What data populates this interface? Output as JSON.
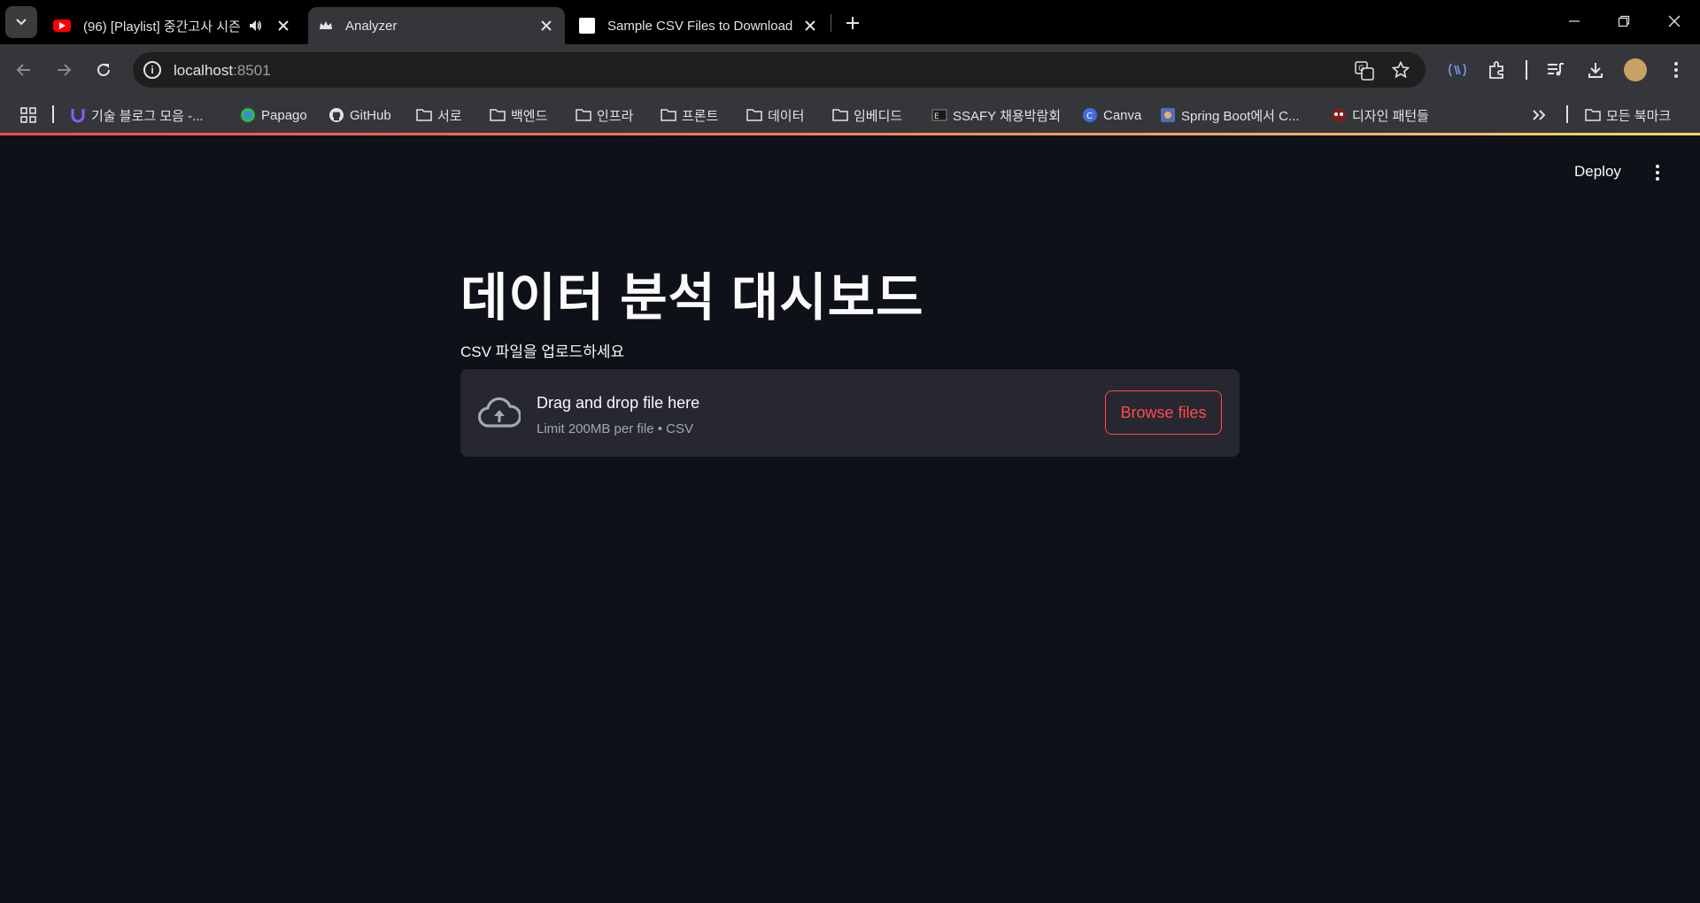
{
  "browser": {
    "tabs": [
      {
        "title": "(96) [Playlist] 중간고사 시즌",
        "favicon": "youtube-icon",
        "active": false
      },
      {
        "title": "Analyzer",
        "favicon": "streamlit-crown-icon",
        "active": true
      },
      {
        "title": "Sample CSV Files to Download",
        "favicon": "page-icon",
        "active": false
      }
    ],
    "address": {
      "host": "localhost",
      "port": ":8501"
    },
    "bookmarks": [
      {
        "label": "기술 블로그 모음 -...",
        "icon": "u-logo-icon"
      },
      {
        "label": "Papago",
        "icon": "papago-icon"
      },
      {
        "label": "GitHub",
        "icon": "github-icon"
      },
      {
        "label": "서로",
        "icon": "folder-icon"
      },
      {
        "label": "백엔드",
        "icon": "folder-icon"
      },
      {
        "label": "인프라",
        "icon": "folder-icon"
      },
      {
        "label": "프론트",
        "icon": "folder-icon"
      },
      {
        "label": "데이터",
        "icon": "folder-icon"
      },
      {
        "label": "임베디드",
        "icon": "folder-icon"
      },
      {
        "label": "SSAFY 채용박람회",
        "icon": "ssafy-icon"
      },
      {
        "label": "Canva",
        "icon": "canva-icon"
      },
      {
        "label": "Spring Boot에서 C...",
        "icon": "spring-icon"
      },
      {
        "label": "디자인 패턴들",
        "icon": "pattern-icon"
      }
    ],
    "all_bookmarks": "모든 북마크"
  },
  "app": {
    "deploy_label": "Deploy",
    "title": "데이터 분석 대시보드",
    "uploader": {
      "label": "CSV 파일을 업로드하세요",
      "drop_text": "Drag and drop file here",
      "limit_text": "Limit 200MB per file • CSV",
      "browse_label": "Browse files"
    }
  },
  "colors": {
    "accent": "#ff4b4b",
    "background": "#0e1117",
    "dropzone": "#262730"
  }
}
